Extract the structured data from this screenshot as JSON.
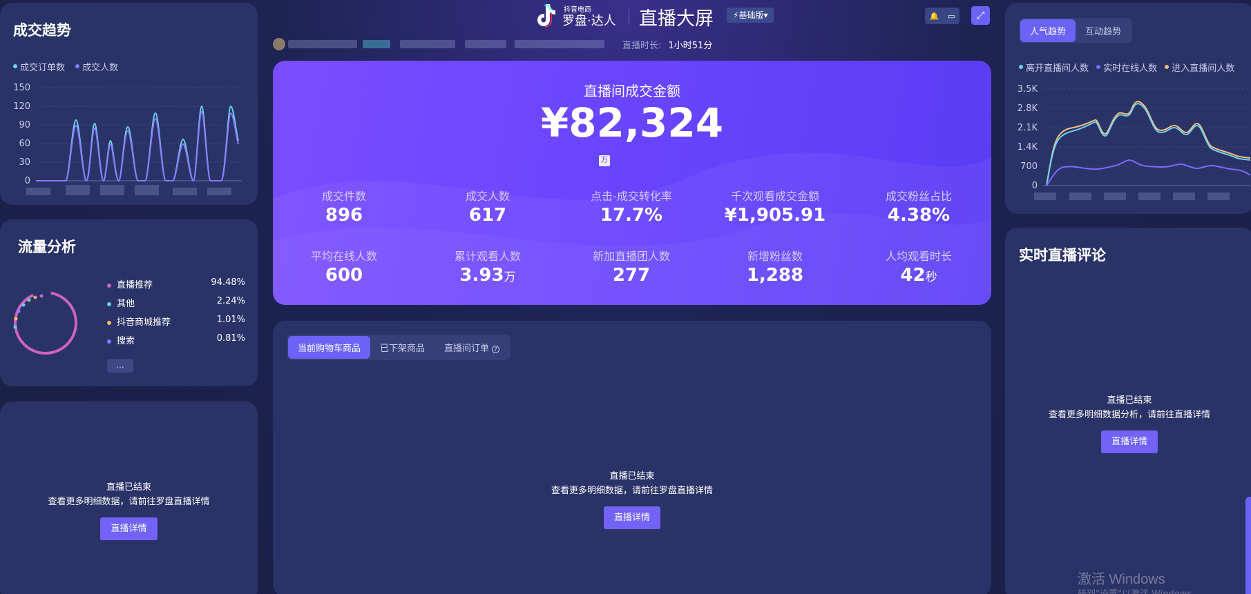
{
  "header": {
    "brand_small": "抖音电商",
    "brand_main": "罗盘·达人",
    "title": "直播大屏",
    "edition": "基础版",
    "duration_label": "直播时长:",
    "duration_value": "1小时51分"
  },
  "trend": {
    "title": "成交趋势",
    "legend": [
      {
        "name": "成交订单数",
        "color": "#6fd3f0"
      },
      {
        "name": "成交人数",
        "color": "#8a7bff"
      }
    ],
    "y_ticks": [
      "150",
      "120",
      "90",
      "60",
      "30",
      "0"
    ]
  },
  "flow": {
    "title": "流量分析",
    "items": [
      {
        "name": "直播推荐",
        "value": "94.48%",
        "color": "#d061c4"
      },
      {
        "name": "其他",
        "value": "2.24%",
        "color": "#5fd6e6"
      },
      {
        "name": "抖音商城推荐",
        "value": "1.01%",
        "color": "#f2c24e"
      },
      {
        "name": "搜索",
        "value": "0.81%",
        "color": "#7a84ff"
      }
    ],
    "more": "..."
  },
  "left_empty": {
    "line1": "直播已结束",
    "line2": "查看更多明细数据，请前往罗盘直播详情",
    "button": "直播详情"
  },
  "stats": {
    "main_label": "直播间成交金额",
    "main_value": "¥82,324",
    "main_unit_badge": "万",
    "row1": [
      {
        "label": "成交件数",
        "value": "896",
        "unit": ""
      },
      {
        "label": "成交人数",
        "value": "617",
        "unit": ""
      },
      {
        "label": "点击-成交转化率",
        "value": "17.7%",
        "unit": ""
      },
      {
        "label": "千次观看成交金额",
        "value": "¥1,905.91",
        "unit": ""
      },
      {
        "label": "成交粉丝占比",
        "value": "4.38%",
        "unit": ""
      }
    ],
    "row2": [
      {
        "label": "平均在线人数",
        "value": "600",
        "unit": ""
      },
      {
        "label": "累计观看人数",
        "value": "3.93",
        "unit": "万"
      },
      {
        "label": "新加直播团人数",
        "value": "277",
        "unit": ""
      },
      {
        "label": "新增粉丝数",
        "value": "1,288",
        "unit": ""
      },
      {
        "label": "人均观看时长",
        "value": "42",
        "unit": "秒"
      }
    ]
  },
  "products": {
    "tabs": [
      "当前购物车商品",
      "已下架商品",
      "直播间订单"
    ],
    "line1": "直播已结束",
    "line2": "查看更多明细数据，请前往罗盘直播详情",
    "button": "直播详情"
  },
  "popular": {
    "tabs": [
      "人气趋势",
      "互动趋势"
    ],
    "legend": [
      {
        "name": "离开直播间人数",
        "color": "#6fd3f0"
      },
      {
        "name": "实时在线人数",
        "color": "#7a6bff"
      },
      {
        "name": "进入直播间人数",
        "color": "#f0c27a"
      }
    ],
    "y_ticks": [
      "3.5K",
      "2.8K",
      "2.1K",
      "1.4K",
      "700",
      "0"
    ]
  },
  "comments": {
    "title": "实时直播评论",
    "line1": "直播已结束",
    "line2": "查看更多明细数据分析，请前往直播详情",
    "button": "直播详情"
  },
  "watermark": {
    "line1": "激活 Windows",
    "line2": "转到\"设置\"以激活 Windows。"
  }
}
